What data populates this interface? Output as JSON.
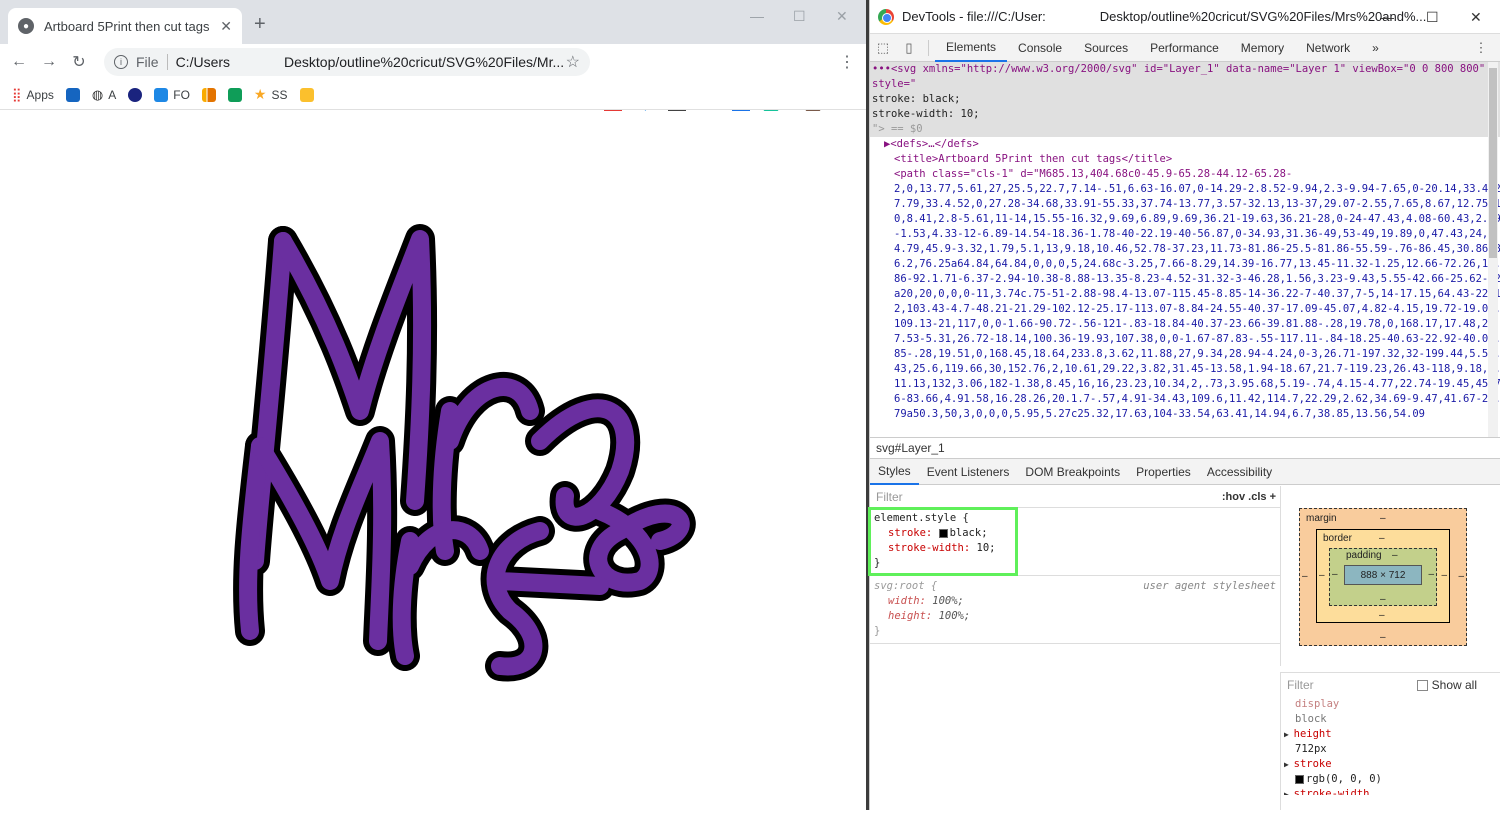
{
  "browser": {
    "tab_title": "Artboard 5Print then cut tags",
    "address": "C:/Users",
    "address_rest": "Desktop/outline%20cricut/SVG%20Files/Mr...",
    "file_label": "File",
    "bookmarks": [
      "Apps",
      "A",
      "FO",
      "SS"
    ],
    "extensions": [
      {
        "name": "abp",
        "label": "ABP",
        "color": "#e53935"
      },
      {
        "name": "cricut",
        "label": "",
        "color": "#1e88e5"
      },
      {
        "name": "mail",
        "label": "M",
        "color": "#424242"
      },
      {
        "name": "save",
        "label": "",
        "color": "#9e9e9e"
      },
      {
        "name": "cast",
        "label": "",
        "color": "#1a73e8"
      },
      {
        "name": "grammarly",
        "label": "G",
        "color": "#15c39a"
      }
    ]
  },
  "artwork": {
    "fill": "#6a2fa0",
    "stroke": "#000000"
  },
  "devtools": {
    "title": "DevTools - file:///C:/User:",
    "title_rest": "Desktop/outline%20cricut/SVG%20Files/Mrs%20and%...",
    "tabs": [
      "Elements",
      "Console",
      "Sources",
      "Performance",
      "Memory",
      "Network"
    ],
    "svg_line1": "•••<svg xmlns=\"http://www.w3.org/2000/svg\" id=\"Layer_1\" data-name=\"Layer 1\" viewBox=\"0 0 800 800\" style=\"",
    "svg_line2": "    stroke: black;",
    "svg_line3": "    stroke-width: 10;",
    "svg_line4": "\"> == $0",
    "defs": "▶<defs>…</defs>",
    "title_tag": "<title>Artboard 5Print then cut tags</title>",
    "path_open": "<path class=\"cls-1\" d=\"M685.13,404.68c0-45.9-65.28-44.12-65.28-",
    "path_data": "2,0,13.77,5.61,27,25.5,22.7,7.14-.51,6.63-16.07,0-14.29-2.8.52-9.94,2.3-9.94-7.65,0-20.14,33.4-27.79,33.4.52,0,27.28-34.68,33.91-55.33,37.74-13.77,3.57-32.13,13-37,29.07-2.55,7.65,8.67,12.75,10,8.41,2.8-5.61,11-14,15.55-16.32,9.69,6.89,9.69,36.21-19.63,36.21-28,0-24-47.43,4.08-60.43,2.29-1.53,4.33-12-6.89-14.54-18.36-1.78-40-22.19-40-56.87,0-34.93,31.36-49,53-49,19.89,0,47.43,24,14.79,45.9-3.32,1.79,5.1,13,9.18,10.46,52.78-37.23,11.73-81.86-25.5-81.86-55.59-.76-86.45,30.86-86.2,76.25a64.84,64.84,0,0,0,5,24.68c-3.25,7.66-8.29,14.39-16.77,13.45-11.32-1.25,12.66-72.26,14.86-92.1.71-6.37-2.94-10.38-8.88-13.35-8.23-4.52-31.32-3-46.28,1.56,3.23-9.43,5.55-42.66-25.62-42a20,20,0,0,0-11,3.74c.75-51-2.88-98.4-13.07-115.45-8.85-14-36.22-7-40.37,7-5,14-17.15,64.43-22.12,103.43-4.7-48.21-21.29-102.12-25.17-113.07-8.84-24.55-40.37-17.09-45.07,4.82-4.15,19.72-19.08,109.13-21,117,0,0-1.66-90.72-.56-121-.83-18.84-40.37-23.66-39.81.88-.28,19.78,0,168.17,17.48,237.53-5.31,26.72-18.14,100.36-19.93,107.38,0,0-1.67-87.83-.55-117.11-.84-18.25-40.63-22.92-40.07.85-.28,19.51,0,168.45,18.64,233.8,3.62,11.88,27,9.34,28.94-4.24,0-3,26.71-197.32,32-199.44,5.57.43,25.6,119.66,30,152.76,2,10.61,29.22,3.82,31.45-13.58,1.94-18.67,21.7-119.23,26.43-118,9.18,0,11.13,132,3.06,182-1.38,8.45,16,16,23.23,10.34,2,.73,3.95.68,5.19-.74,4.15-4.77,22.74-19.45,45.76-83.66,4.91.58,16.28.26,20.1.7-.57,4.91-34.43,109.6,11.42,114.7,22.29,2.62,34.69-9.47,41.67-22.79a50.3,50,3,0,0,0,5.95,5.27c25.32,17.63,104-33.54,63.41,14.94,6.7,38.85,13.56,54.09",
    "crumb": "svg#Layer_1",
    "subtabs": [
      "Styles",
      "Event Listeners",
      "DOM Breakpoints",
      "Properties",
      "Accessibility"
    ],
    "filter_placeholder": "Filter",
    "filter_tools": ":hov  .cls  +",
    "element_style_sel": "element.style {",
    "prop_stroke": "stroke:",
    "prop_stroke_val": "black;",
    "prop_width": "stroke-width:",
    "prop_width_val": "10;",
    "close_brace": "}",
    "svgroot_sel": "svg:root {",
    "ua_label": "user agent stylesheet",
    "prop_w": "width:",
    "prop_w_val": "100%;",
    "prop_h": "height:",
    "prop_h_val": "100%;",
    "box": {
      "margin": "margin",
      "border": "border",
      "padding": "padding",
      "content": "888 × 712",
      "dash": "–"
    },
    "computed": {
      "filter": "Filter",
      "show_all": "Show all",
      "display_prop": "display",
      "display_val": "block",
      "height_prop": "height",
      "height_val": "712px",
      "stroke_prop": "stroke",
      "stroke_val": "rgb(0, 0, 0)",
      "stroke_width_prop": "stroke-width"
    }
  }
}
